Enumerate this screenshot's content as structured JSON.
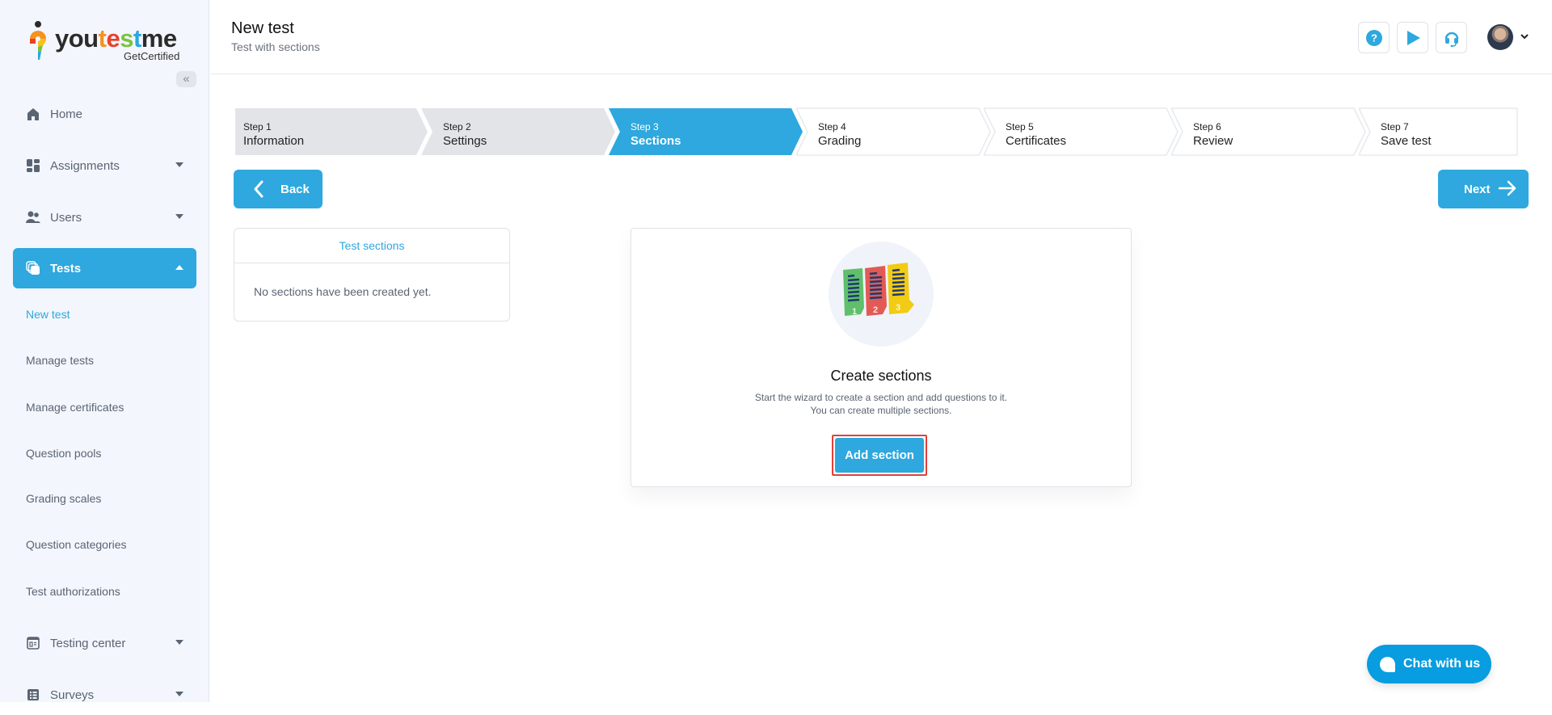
{
  "brand": {
    "name_parts": [
      "you",
      "t",
      "e",
      "s",
      "t",
      "me"
    ],
    "tagline": "GetCertified",
    "accent": "#2ea8de"
  },
  "sidebar": {
    "collapse_icon": "double-chevron-left-icon",
    "items": [
      {
        "label": "Home",
        "icon": "home-icon",
        "has_caret": false
      },
      {
        "label": "Assignments",
        "icon": "assignments-icon",
        "has_caret": true
      },
      {
        "label": "Users",
        "icon": "users-icon",
        "has_caret": true
      },
      {
        "label": "Tests",
        "icon": "tests-icon",
        "has_caret": true,
        "active": true
      },
      {
        "label": "Testing center",
        "icon": "testing-center-icon",
        "has_caret": true
      },
      {
        "label": "Surveys",
        "icon": "surveys-icon",
        "has_caret": true
      }
    ],
    "sub_items": [
      {
        "label": "New test",
        "current": true
      },
      {
        "label": "Manage tests"
      },
      {
        "label": "Manage certificates"
      },
      {
        "label": "Question pools"
      },
      {
        "label": "Grading scales"
      },
      {
        "label": "Question categories"
      },
      {
        "label": "Test authorizations"
      }
    ]
  },
  "header": {
    "title": "New test",
    "subtitle": "Test with sections",
    "buttons": [
      "help-icon",
      "play-icon",
      "headset-icon"
    ]
  },
  "stepper": {
    "current_step": 3,
    "steps": [
      {
        "step": "Step 1",
        "label": "Information",
        "state": "done"
      },
      {
        "step": "Step 2",
        "label": "Settings",
        "state": "done"
      },
      {
        "step": "Step 3",
        "label": "Sections",
        "state": "active"
      },
      {
        "step": "Step 4",
        "label": "Grading",
        "state": "todo"
      },
      {
        "step": "Step 5",
        "label": "Certificates",
        "state": "todo"
      },
      {
        "step": "Step 6",
        "label": "Review",
        "state": "todo"
      },
      {
        "step": "Step 7",
        "label": "Save test",
        "state": "todo"
      }
    ]
  },
  "nav_buttons": {
    "back": "Back",
    "next": "Next"
  },
  "sections_panel": {
    "title": "Test sections",
    "empty_text": "No sections have been created yet."
  },
  "create_card": {
    "title": "Create sections",
    "description_line1": "Start the wizard to create a section and add questions to it.",
    "description_line2": "You can create multiple sections.",
    "button": "Add section",
    "illustration_numbers": [
      "1",
      "2",
      "3"
    ]
  },
  "chat": {
    "label": "Chat with us"
  }
}
